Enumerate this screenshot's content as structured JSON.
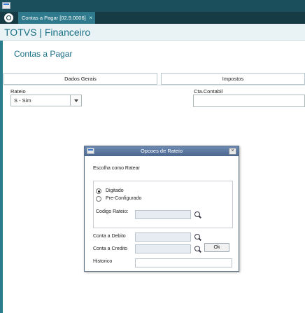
{
  "window": {
    "tab_label": "Contas a Pagar [02.9.0006]",
    "tab_close": "×"
  },
  "header": {
    "brand": "TOTVS | Financeiro"
  },
  "page": {
    "title": "Contas a Pagar"
  },
  "tabs": [
    {
      "label": "Dados Gerais"
    },
    {
      "label": "Impostos"
    }
  ],
  "form": {
    "rateio_label": "Rateio",
    "rateio_value": "S - Sim",
    "cta_contabil_label": "Cta.Contabil",
    "cta_contabil_value": ""
  },
  "dialog": {
    "title": "Opcoes de Rateio",
    "close": "×",
    "prompt": "Escolha como Ratear",
    "options": [
      {
        "label": "Digitado",
        "selected": true
      },
      {
        "label": "Pre-Configurado",
        "selected": false
      }
    ],
    "codigo_rateio_label": "Codigo Rateio:",
    "codigo_rateio_value": "",
    "conta_debito_label": "Conta a Debito",
    "conta_debito_value": "",
    "conta_credito_label": "Conta a Credito",
    "conta_credito_value": "",
    "historico_label": "Historico",
    "historico_value": "",
    "ok_label": "Ok"
  },
  "colors": {
    "topbar": "#1c4f5c",
    "tabbar": "#163b45",
    "active_tab": "#2e7a8c",
    "brand_text": "#1b6f86",
    "dialog_title": "#4b6790"
  }
}
